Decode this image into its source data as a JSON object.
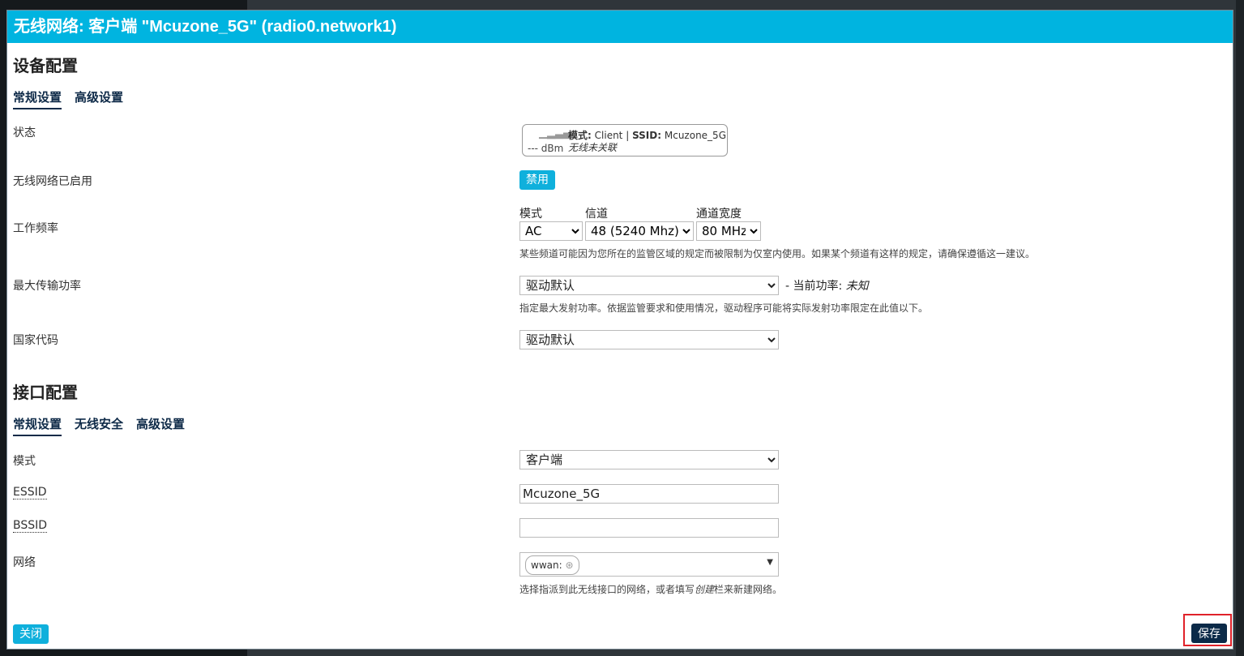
{
  "modal": {
    "title": "无线网络: 客户端 \"Mcuzone_5G\" (radio0.network1)"
  },
  "device": {
    "title": "设备配置",
    "tabs": [
      "常规设置",
      "高级设置"
    ],
    "status": {
      "label": "状态",
      "dbm": "--- dBm",
      "mode_key": "模式:",
      "mode_val": "Client",
      "ssid_key": "SSID:",
      "ssid_val": "Mcuzone_5G",
      "assoc": "无线未关联"
    },
    "enabled": {
      "label": "无线网络已启用",
      "button": "禁用"
    },
    "freq": {
      "label": "工作频率",
      "mode_label": "模式",
      "mode_value": "AC",
      "channel_label": "信道",
      "channel_value": "48 (5240 Mhz)",
      "width_label": "通道宽度",
      "width_value": "80 MHz",
      "hint": "某些频道可能因为您所在的监管区域的规定而被限制为仅室内使用。如果某个频道有这样的规定，请确保遵循这一建议。"
    },
    "txpower": {
      "label": "最大传输功率",
      "value": "驱动默认",
      "current_prefix": "- 当前功率:",
      "current_value": "未知",
      "hint": "指定最大发射功率。依据监管要求和使用情况，驱动程序可能将实际发射功率限定在此值以下。"
    },
    "country": {
      "label": "国家代码",
      "value": "驱动默认"
    }
  },
  "iface": {
    "title": "接口配置",
    "tabs": [
      "常规设置",
      "无线安全",
      "高级设置"
    ],
    "mode": {
      "label": "模式",
      "value": "客户端"
    },
    "essid": {
      "label": "ESSID",
      "value": "Mcuzone_5G"
    },
    "bssid": {
      "label": "BSSID",
      "value": ""
    },
    "network": {
      "label": "网络",
      "chip": "wwan:",
      "hint_pre": "选择指派到此无线接口的网络，或者填写",
      "hint_em": "创建",
      "hint_post": "栏来新建网络。"
    }
  },
  "footer": {
    "close": "关闭",
    "save": "保存"
  },
  "colors": {
    "header": "#00b4e0",
    "accent_button": "#0fb0dc",
    "save_button": "#0b2a48",
    "highlight": "#e0222a"
  }
}
